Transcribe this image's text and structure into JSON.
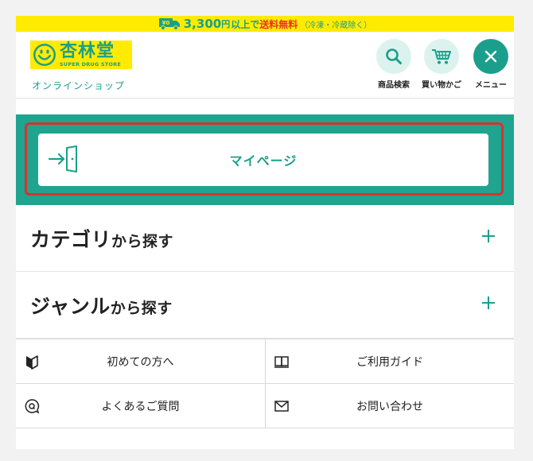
{
  "promo": {
    "truck_label": "¥0",
    "amount": "3,300",
    "unit": "円",
    "text1": "以上で",
    "free": "送料無料",
    "note": "（冷凍・冷蔵除く）"
  },
  "header": {
    "logo_name": "杏林堂",
    "logo_sub": "SUPER DRUG STORE",
    "shop_label": "オンラインショップ",
    "search_label": "商品検索",
    "cart_label": "買い物かご",
    "menu_label": "メニュー"
  },
  "mypage": {
    "label": "マイページ"
  },
  "accordions": [
    {
      "title_main": "カテゴリ",
      "title_suffix": "から探す"
    },
    {
      "title_main": "ジャンル",
      "title_suffix": "から探す"
    }
  ],
  "links": [
    {
      "label": "初めての方へ",
      "icon": "beginner-mark-icon"
    },
    {
      "label": "ご利用ガイド",
      "icon": "book-icon"
    },
    {
      "label": "よくあるご質問",
      "icon": "faq-icon"
    },
    {
      "label": "お問い合わせ",
      "icon": "mail-icon"
    }
  ],
  "colors": {
    "brand": "#1b9f8c",
    "yellow": "#ffeb00",
    "red": "#e8322b",
    "frame": "#d7332e"
  }
}
